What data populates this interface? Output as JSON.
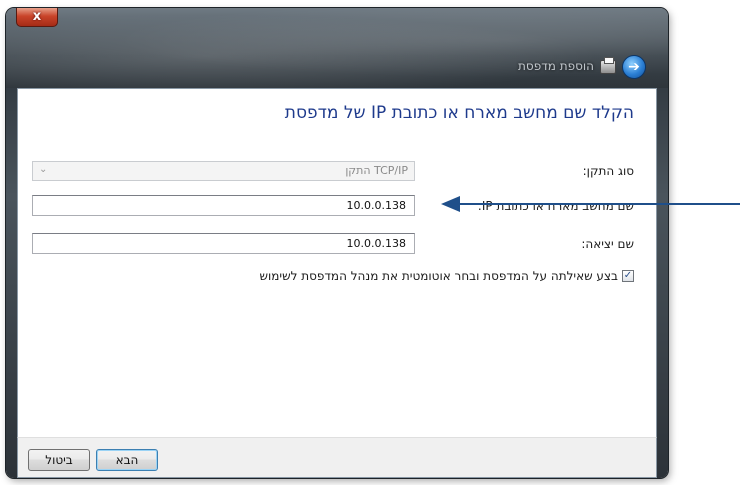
{
  "window": {
    "title": "הוספת מדפסת",
    "close_glyph": "x",
    "back_glyph": "➔"
  },
  "main": {
    "heading": "הקלד שם מחשב מארח או כתובת IP של מדפסת",
    "device_type": {
      "label": "סוג התקן:",
      "value": "התקן TCP/IP",
      "arrow": "⌄"
    },
    "hostname": {
      "label": "שם מחשב מארח או כתובת IP:",
      "value": "10.0.0.138"
    },
    "port_name": {
      "label": "שם יציאה:",
      "value": "10.0.0.138"
    },
    "query_printer": {
      "label": "בצע שאילתה על המדפסת ובחר אוטומטית את מנהל המדפסת לשימוש",
      "checked": true,
      "check_glyph": "✓"
    }
  },
  "buttons": {
    "next_label": "הבא",
    "cancel_label": "ביטול"
  },
  "colors": {
    "heading": "#1e3a8c",
    "callout_arrow": "#1f4f8a"
  }
}
